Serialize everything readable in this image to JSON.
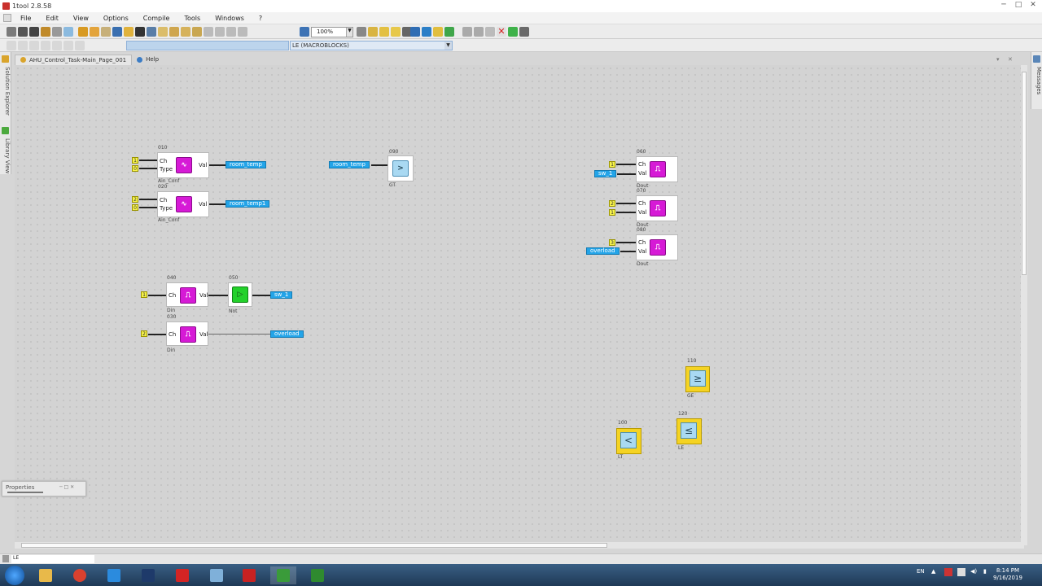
{
  "window": {
    "title": "1tool 2.8.58"
  },
  "menu": [
    "File",
    "Edit",
    "View",
    "Options",
    "Compile",
    "Tools",
    "Windows",
    "?"
  ],
  "toolbar": {
    "zoom": "100%",
    "block_select": "LE (MACROBLOCKS)"
  },
  "tabs": {
    "page": "AHU_Control_Task-Main_Page_001",
    "help": "Help"
  },
  "rails": {
    "solution_explorer": "Solution Explorer",
    "library_view": "Library View",
    "messages": "Messages"
  },
  "blocks": {
    "b010": {
      "num": "010",
      "caption": "Ain_Conf",
      "pins": [
        "Ch",
        "Type",
        "Val"
      ],
      "consts": [
        "1",
        "0"
      ]
    },
    "b020": {
      "num": "020",
      "caption": "Ain_Conf",
      "pins": [
        "Ch",
        "Type",
        "Val"
      ],
      "consts": [
        "2",
        "0"
      ]
    },
    "b090": {
      "num": "090",
      "caption": "GT"
    },
    "b040": {
      "num": "040",
      "caption": "Din",
      "pins": [
        "Ch",
        "Val"
      ],
      "consts": [
        "1"
      ]
    },
    "b030": {
      "num": "030",
      "caption": "Din",
      "pins": [
        "Ch",
        "Val"
      ],
      "consts": [
        "2"
      ]
    },
    "b050": {
      "num": "050",
      "caption": "Not"
    },
    "b060": {
      "num": "060",
      "caption": "Dout",
      "pins": [
        "Ch",
        "Val"
      ],
      "consts": [
        "1"
      ]
    },
    "b070": {
      "num": "070",
      "caption": "Dout",
      "pins": [
        "Ch",
        "Val"
      ],
      "consts": [
        "2",
        "1"
      ]
    },
    "b080": {
      "num": "080",
      "caption": "Dout",
      "pins": [
        "Ch",
        "Val"
      ],
      "consts": [
        "3"
      ]
    },
    "b110": {
      "num": "110",
      "caption": "GE"
    },
    "b100": {
      "num": "100",
      "caption": "LT"
    },
    "b120": {
      "num": "120",
      "caption": "LE"
    }
  },
  "tags": {
    "room_temp_out": "room_temp",
    "room_temp1_out": "room_temp1",
    "room_temp_in": "room_temp",
    "sw1_out": "sw_1",
    "overload_out": "overload",
    "sw1_in": "sw_1",
    "overload_in": "overload"
  },
  "panels": {
    "properties": "Properties"
  },
  "statusbar": {
    "input": "LE"
  },
  "tray": {
    "lang": "EN",
    "time": "8:14 PM",
    "date": "9/16/2019"
  }
}
